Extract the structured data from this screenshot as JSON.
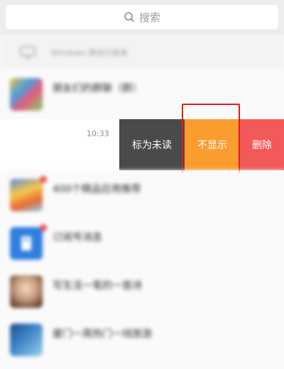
{
  "search": {
    "placeholder": "搜索"
  },
  "win_notice": {
    "text": "Windows 微信已登录"
  },
  "swiped": {
    "time": "10:33",
    "actions": {
      "mark_unread": "标为未读",
      "hide": "不显示",
      "delete": "删除"
    }
  },
  "colors": {
    "mark_unread_bg": "#4a4a4a",
    "hide_bg": "#fb9d2e",
    "delete_bg": "#f25a5a",
    "highlight_border": "#e41b1b"
  },
  "chats_blurred": [
    {
      "title": "朋友们的群聊（群）",
      "sub": "",
      "time": ""
    },
    {
      "title": "400个精品应用推荐",
      "sub": "",
      "time": ""
    },
    {
      "title": "订阅号消息",
      "sub": "",
      "time": ""
    },
    {
      "title": "写生活一笔的一首诗",
      "sub": "",
      "time": ""
    },
    {
      "title": "厦门一周热门一线旅游",
      "sub": "",
      "time": ""
    }
  ]
}
